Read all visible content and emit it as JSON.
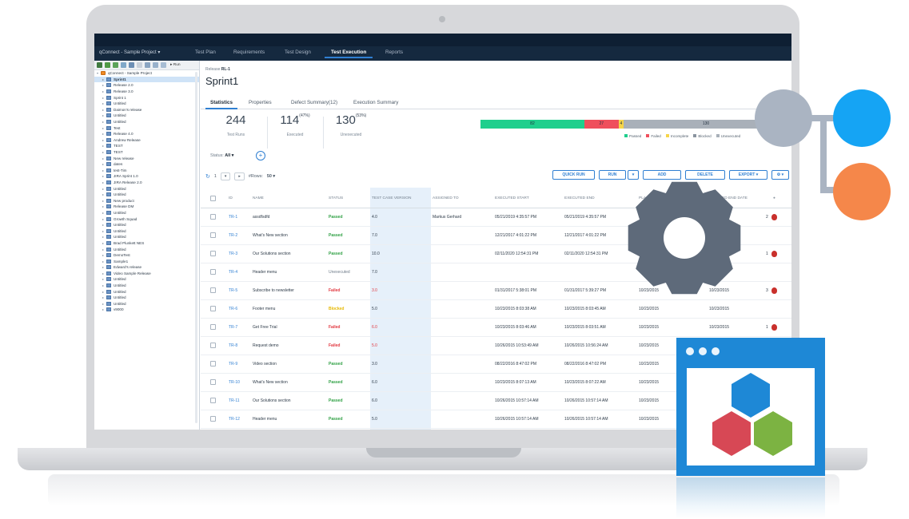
{
  "app": {
    "project_menu": "qConnect - Sample Project ▾",
    "nav": [
      "Test Plan",
      "Requirements",
      "Test Design",
      "Test Execution",
      "Reports"
    ],
    "active_nav": "Test Execution"
  },
  "tree": {
    "run_label": "Run",
    "root": "qConnect - Sample Project",
    "items": [
      "Sprint1",
      "Release 2.0",
      "Release 3.0",
      "Sprint 1",
      "Untitled",
      "Daimon's release",
      "Untitled",
      "Untitled",
      "Test",
      "Release 4.0",
      "Andrew Release",
      "TEST",
      "TEST",
      "New release",
      "dates",
      "test-Tim",
      "JIRA Sprint 1.0",
      "JIRA Release 2.0",
      "Untitled",
      "Untitled",
      "New product",
      "Release DM",
      "Untitled",
      "Growth Squad",
      "Untitled",
      "Untitled",
      "Untitled",
      "Brad Plunkett NES",
      "Untitled",
      "DemoTest",
      "Sample1",
      "Edward's release",
      "Video Sample Release",
      "Untitled",
      "Untitled",
      "Untitled",
      "Untitled",
      "Untitled",
      "v9000"
    ]
  },
  "main": {
    "breadcrumb_label": "Release",
    "breadcrumb_value": "RL-1",
    "title": "Sprint1",
    "tabs": [
      "Statistics",
      "Properties",
      "Defect Summary(12)",
      "Execution Summary"
    ],
    "stats": [
      {
        "value": "244",
        "pct": "",
        "label": "Test Runs"
      },
      {
        "value": "114",
        "pct": "(47%)",
        "label": "Executed"
      },
      {
        "value": "130",
        "pct": "(53%)",
        "label": "Unexecuted"
      }
    ],
    "progress": {
      "segments": [
        {
          "label": "82",
          "value": 82,
          "color": "#1fcf8d"
        },
        {
          "label": "27",
          "value": 27,
          "color": "#ef4f5c"
        },
        {
          "label": "4",
          "value": 4,
          "color": "#f6d548"
        },
        {
          "label": "130",
          "value": 130,
          "color": "#a9b0b9"
        }
      ],
      "legend": [
        "Passed",
        "Failed",
        "Incomplete",
        "Blocked",
        "Unexecuted"
      ],
      "legend_colors": [
        "#1fcf8d",
        "#ef4f5c",
        "#f6d548",
        "#8a949f",
        "#a9b0b9"
      ]
    },
    "status_filter_label": "Status:",
    "status_filter_value": "All ▾",
    "plus_icon": "+",
    "pager": {
      "page": "1",
      "rows_label": "#Rows:",
      "rows_value": "50 ▾"
    },
    "buttons": [
      "QUICK RUN",
      "RUN",
      "▾",
      "ADD",
      "DELETE",
      "EXPORT ▾",
      "⚙ ▾"
    ],
    "columns": [
      "ID",
      "NAME",
      "STATUS",
      "TEST CASE VERSION",
      "ASSIGNED TO",
      "EXECUTED START",
      "EXECUTED END",
      "PLANNED START",
      "PLANNED END DATE"
    ],
    "rows": [
      {
        "id": "TR-1",
        "name": "assdfsdfd",
        "status": "Passed",
        "version": "4.0",
        "assigned": "Markus Gerhard",
        "exec_start": "05/21/2019 4:35:57 PM",
        "exec_end": "05/21/2019 4:35:57 PM",
        "plan_start": "",
        "plan_end": "2015",
        "defects": "2"
      },
      {
        "id": "TR-2",
        "name": "What's New section",
        "status": "Passed",
        "version": "7.0",
        "assigned": "",
        "exec_start": "12/21/2017 4:01:22 PM",
        "exec_end": "12/21/2017 4:01:22 PM",
        "plan_start": "",
        "plan_end": "2015",
        "defects": ""
      },
      {
        "id": "TR-3",
        "name": "Our Solutions section",
        "status": "Passed",
        "version": "10.0",
        "assigned": "",
        "exec_start": "02/11/2020 12:54:31 PM",
        "exec_end": "02/11/2020 12:54:31 PM",
        "plan_start": "15",
        "plan_end": "2015",
        "defects": "1"
      },
      {
        "id": "TR-4",
        "name": "Header menu",
        "status": "Unexecuted",
        "version": "7.0",
        "assigned": "",
        "exec_start": "",
        "exec_end": "",
        "plan_start": "",
        "plan_end": "2015",
        "defects": ""
      },
      {
        "id": "TR-5",
        "name": "Subscribe to newsletter",
        "status": "Failed",
        "version": "3.0",
        "assigned": "",
        "exec_start": "01/31/2017 5:38:01 PM",
        "exec_end": "01/31/2017 5:39:27 PM",
        "plan_start": "10/23/2015",
        "plan_end": "10/23/2015",
        "defects": "3"
      },
      {
        "id": "TR-6",
        "name": "Footer menu",
        "status": "Blocked",
        "version": "5.0",
        "assigned": "",
        "exec_start": "10/23/2015 8:03:38 AM",
        "exec_end": "10/23/2015 8:03:45 AM",
        "plan_start": "10/23/2015",
        "plan_end": "10/23/2015",
        "defects": ""
      },
      {
        "id": "TR-7",
        "name": "Get Free Trial",
        "status": "Failed",
        "version": "6.0",
        "assigned": "",
        "exec_start": "10/23/2015 8:03:46 AM",
        "exec_end": "10/23/2015 8:03:51 AM",
        "plan_start": "10/23/2015",
        "plan_end": "10/23/2015",
        "defects": "1"
      },
      {
        "id": "TR-8",
        "name": "Request demo",
        "status": "Failed",
        "version": "5.0",
        "assigned": "",
        "exec_start": "10/26/2015 10:53:49 AM",
        "exec_end": "10/26/2015 10:56:24 AM",
        "plan_start": "10/23/2015",
        "plan_end": "10/23/2015",
        "defects": ""
      },
      {
        "id": "TR-9",
        "name": "Video section",
        "status": "Passed",
        "version": "3.0",
        "assigned": "",
        "exec_start": "08/22/2016 8:47:02 PM",
        "exec_end": "08/22/2016 8:47:02 PM",
        "plan_start": "10/23/2015",
        "plan_end": "",
        "defects": ""
      },
      {
        "id": "TR-10",
        "name": "What's New section",
        "status": "Passed",
        "version": "6.0",
        "assigned": "",
        "exec_start": "10/23/2015 8:07:13 AM",
        "exec_end": "10/23/2015 8:07:22 AM",
        "plan_start": "10/23/2015",
        "plan_end": "",
        "defects": ""
      },
      {
        "id": "TR-11",
        "name": "Our Solutions section",
        "status": "Passed",
        "version": "6.0",
        "assigned": "",
        "exec_start": "10/26/2015 10:57:14 AM",
        "exec_end": "10/26/2015 10:57:14 AM",
        "plan_start": "10/23/2015",
        "plan_end": "",
        "defects": ""
      },
      {
        "id": "TR-12",
        "name": "Header menu",
        "status": "Passed",
        "version": "5.0",
        "assigned": "",
        "exec_start": "10/26/2015 10:57:14 AM",
        "exec_end": "10/26/2015 10:57:14 AM",
        "plan_start": "10/23/2015",
        "plan_end": "",
        "defects": ""
      }
    ]
  },
  "colors": {
    "nav_bg": "#15293f",
    "accent": "#2f7fd2",
    "gear": "#5e6a7a",
    "node_gray": "#aab4c2",
    "node_blue": "#15a4f4",
    "node_orange": "#f5874a",
    "window_blue": "#1e88d6",
    "hex_blue": "#1e88d6",
    "hex_red": "#d74855",
    "hex_green": "#7cb342"
  }
}
